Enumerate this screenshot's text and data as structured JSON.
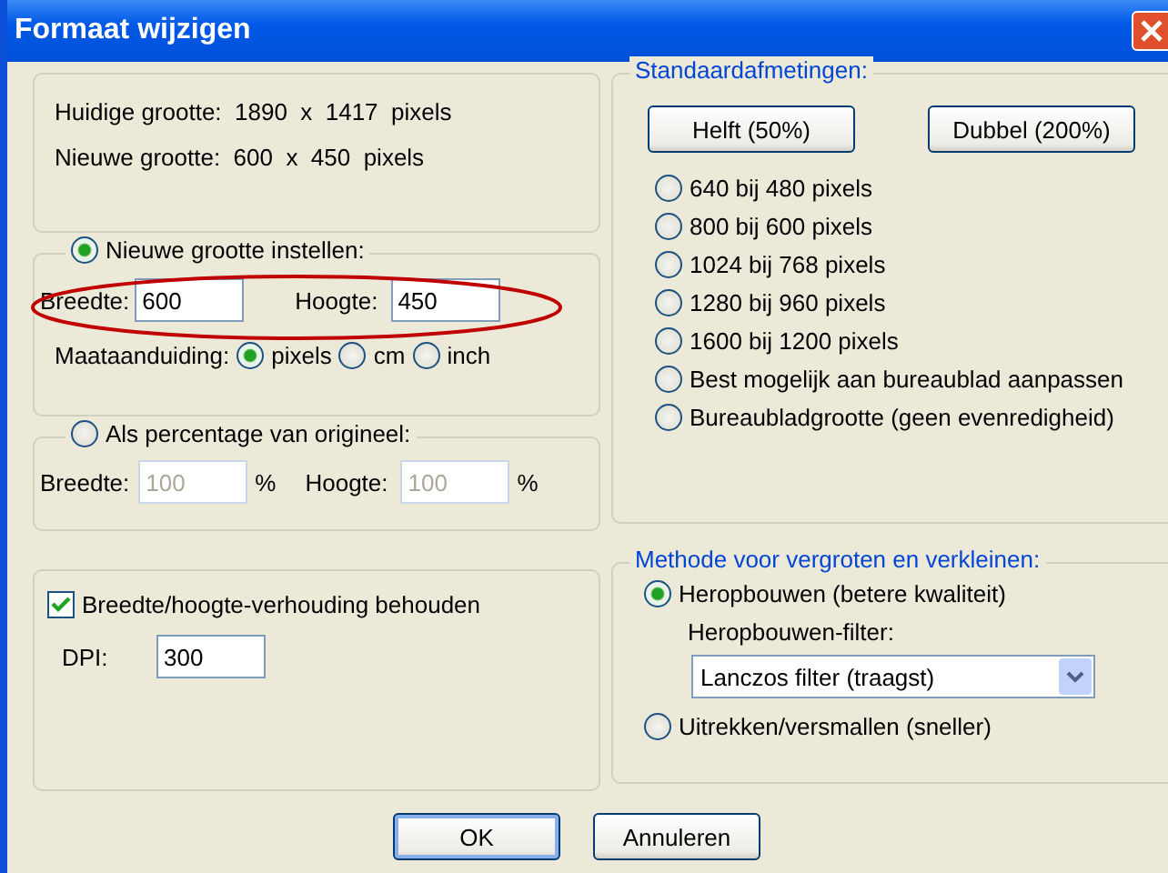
{
  "window": {
    "title": "Formaat wijzigen"
  },
  "info": {
    "current": "Huidige grootte:  1890  x  1417  pixels",
    "new": "Nieuwe grootte:  600  x  450  pixels"
  },
  "new_size": {
    "label": "Nieuwe grootte instellen:",
    "selected": true,
    "width_label": "Breedte:",
    "width_value": "600",
    "height_label": "Hoogte:",
    "height_value": "450",
    "unit_label": "Maataanduiding:",
    "units": [
      {
        "label": "pixels",
        "selected": true
      },
      {
        "label": "cm",
        "selected": false
      },
      {
        "label": "inch",
        "selected": false
      }
    ]
  },
  "percent": {
    "label": "Als percentage van origineel:",
    "selected": false,
    "disabled": true,
    "width_label": "Breedte:",
    "width_value": "100",
    "width_suffix": "%",
    "height_label": "Hoogte:",
    "height_value": "100",
    "height_suffix": "%"
  },
  "aspect": {
    "label": "Breedte/hoogte-verhouding behouden",
    "checked": true,
    "dpi_label": "DPI:",
    "dpi_value": "300"
  },
  "standard": {
    "title": "Standaardafmetingen:",
    "buttons": [
      "Helft (50%)",
      "Dubbel (200%)"
    ],
    "options": [
      {
        "label": "640 bij 480 pixels",
        "selected": false
      },
      {
        "label": "800 bij 600 pixels",
        "selected": false
      },
      {
        "label": "1024 bij 768 pixels",
        "selected": false
      },
      {
        "label": "1280 bij 960 pixels",
        "selected": false
      },
      {
        "label": "1600 bij 1200 pixels",
        "selected": false
      },
      {
        "label": "Best mogelijk aan bureaublad aanpassen",
        "selected": false
      },
      {
        "label": "Bureaubladgrootte (geen evenredigheid)",
        "selected": false
      }
    ]
  },
  "method": {
    "title": "Methode voor vergroten en verkleinen:",
    "options": [
      {
        "label": "Heropbouwen (betere kwaliteit)",
        "selected": true
      },
      {
        "label": "Uitrekken/versmallen (sneller)",
        "selected": false
      }
    ],
    "filter_label": "Heropbouwen-filter:",
    "filter_value": "Lanczos filter (traagst)"
  },
  "buttons": [
    {
      "label": "OK",
      "default": true
    },
    {
      "label": "Annuleren",
      "default": false
    }
  ]
}
